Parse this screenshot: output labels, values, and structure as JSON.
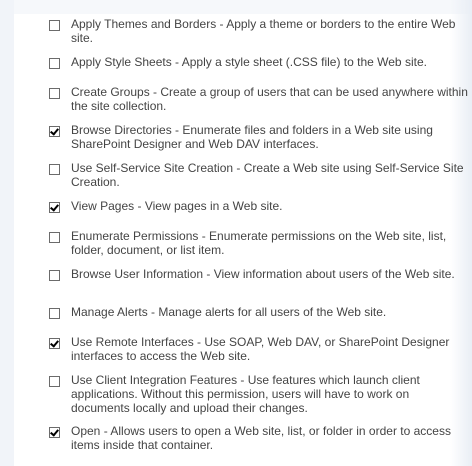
{
  "permissions": [
    {
      "label": "Apply Themes and Borders  -  Apply a theme or borders to the entire Web site.",
      "checked": false
    },
    {
      "label": "Apply Style Sheets  -  Apply a style sheet (.CSS file) to the Web site.",
      "checked": false
    },
    {
      "label": "Create Groups  -  Create a group of users that can be used anywhere within the site collection.",
      "checked": false
    },
    {
      "label": "Browse Directories  -  Enumerate files and folders in a Web site using SharePoint Designer and Web DAV interfaces.",
      "checked": true
    },
    {
      "label": "Use Self-Service Site Creation  -  Create a Web site using Self-Service Site Creation.",
      "checked": false
    },
    {
      "label": "View Pages  -  View pages in a Web site.",
      "checked": true
    },
    {
      "label": "Enumerate Permissions  -  Enumerate permissions on the Web site, list, folder, document, or list item.",
      "checked": false
    },
    {
      "label": "Browse User Information  -  View information about users of the Web site.",
      "checked": false
    },
    {
      "label": "Manage Alerts  -  Manage alerts for all users of the Web site.",
      "checked": false
    },
    {
      "label": "Use Remote Interfaces  -  Use SOAP, Web DAV, or SharePoint Designer interfaces to access the Web site.",
      "checked": true
    },
    {
      "label": "Use Client Integration Features  -  Use features which launch client applications. Without this permission, users will have to work on documents locally and upload their changes.",
      "checked": false
    },
    {
      "label": "Open  -  Allows users to open a Web site, list, or folder in order to access items inside that container.",
      "checked": true
    }
  ]
}
